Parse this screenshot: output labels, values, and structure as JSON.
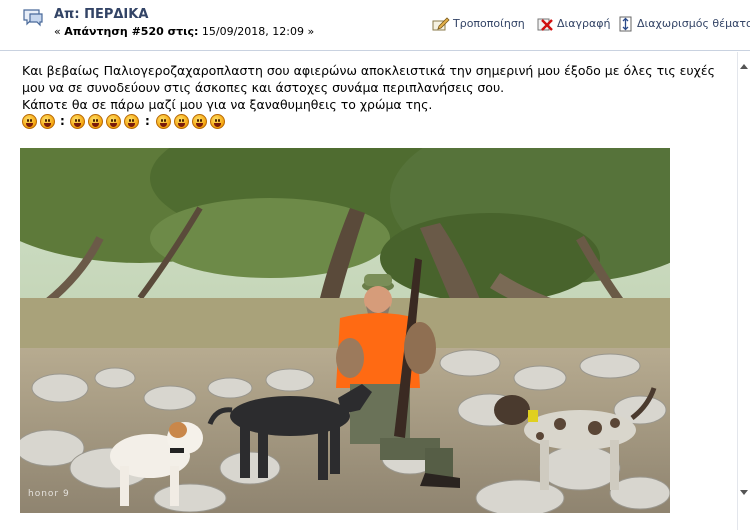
{
  "post": {
    "title": "Απ: ΠΕΡΔΙΚΑ",
    "meta_prefix": "«",
    "reply_label": "Απάντηση #520 στις:",
    "date": "15/09/2018, 12:09",
    "meta_suffix": "»"
  },
  "actions": {
    "edit": "Τροποποίηση",
    "delete": "Διαγραφή",
    "split": "Διαχωρισμός θέματος"
  },
  "body": {
    "line1": "Και βεβαίως Παλιογεροζαχαροπλαστη σου αφιερώνω αποκλειστικά την σημερινή μου έξοδο με όλες τις ευχές",
    "line2": "μου να σε συνοδεύουν στις άσκοπες και άστοχες συνάμα περιπλανήσεις σου.",
    "line3": "Κάποτε θα σε πάρω μαζί μου για να ξαναθυμηθεις το χρώμα της.",
    "separator": ":"
  },
  "smileys": [
    "tongue-smiley",
    "tongue-smiley",
    "tongue-smiley",
    "tongue-smiley",
    "tongue-smiley",
    "tongue-smiley",
    "tongue-smiley",
    "tongue-smiley",
    "tongue-smiley"
  ],
  "photo": {
    "watermark": "honor 9"
  },
  "colors": {
    "title": "#334466",
    "border": "#c9d2e0",
    "vest": "#ff6a13"
  }
}
